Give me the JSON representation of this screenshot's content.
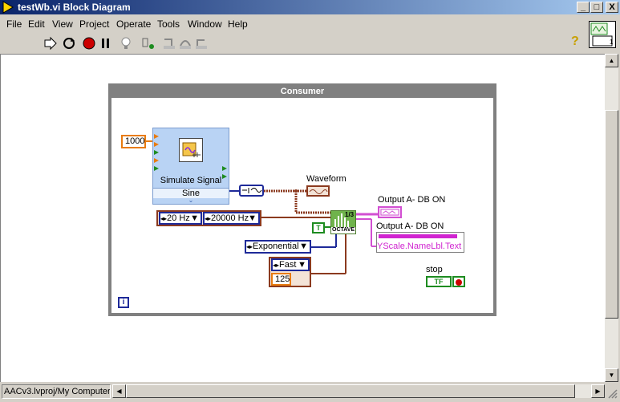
{
  "window": {
    "title": "testWb.vi Block Diagram",
    "min": "_",
    "max": "□",
    "close": "X"
  },
  "menu": [
    "File",
    "Edit",
    "View",
    "Project",
    "Operate",
    "Tools",
    "Window",
    "Help"
  ],
  "toolbar": {
    "buttons": [
      "run-arrow-icon",
      "run-continuous-icon",
      "abort-icon",
      "pause-icon",
      "highlight-execution-icon",
      "retain-wire-values-icon",
      "step-into-icon",
      "step-over-icon",
      "step-out-icon"
    ],
    "help_label": "?"
  },
  "diagram": {
    "loop_label": "Consumer",
    "const_1000": "1000",
    "simulate_signal_name": "Simulate Signal",
    "simulate_signal_mode": "Sine",
    "waveform_label": "Waveform",
    "freq_low": "20 Hz",
    "freq_high": "20000 Hz",
    "exponential": "Exponential",
    "fast": "Fast",
    "const_125": "125",
    "octave_top": "1/3",
    "octave_bottom": "OCTAVE",
    "output_a_1": "Output A- DB ON",
    "output_a_2": "Output A- DB ON",
    "yscale_text": "YScale.NameLbl.Text",
    "stop_label": "stop",
    "tf_text": "TF",
    "t_text": "T",
    "info": "i"
  },
  "status": {
    "path": "AACv3.lvproj/My Computer"
  },
  "colors": {
    "numeric": "#e87b10",
    "enum": "#1e2a99",
    "boolean": "#1e8c20",
    "cluster": "#d24fd2",
    "waveform": "#8b3a1f"
  }
}
